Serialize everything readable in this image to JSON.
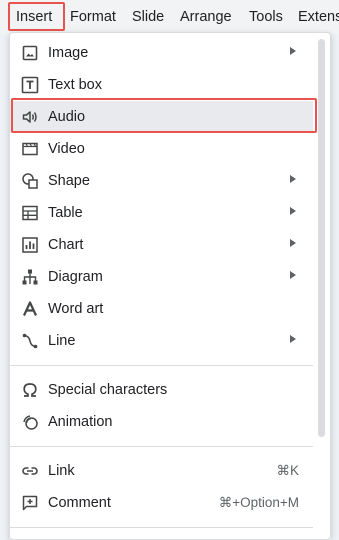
{
  "menubar": {
    "items": [
      "Insert",
      "Format",
      "Slide",
      "Arrange",
      "Tools",
      "Extens"
    ],
    "active": "Insert"
  },
  "dropdown": {
    "items": [
      {
        "label": "Image",
        "icon": "image-icon",
        "submenu": true
      },
      {
        "label": "Text box",
        "icon": "text-box-icon",
        "submenu": false
      },
      {
        "label": "Audio",
        "icon": "audio-icon",
        "submenu": false,
        "highlighted": true
      },
      {
        "label": "Video",
        "icon": "video-icon",
        "submenu": false
      },
      {
        "label": "Shape",
        "icon": "shape-icon",
        "submenu": true
      },
      {
        "label": "Table",
        "icon": "table-icon",
        "submenu": true
      },
      {
        "label": "Chart",
        "icon": "chart-icon",
        "submenu": true
      },
      {
        "label": "Diagram",
        "icon": "diagram-icon",
        "submenu": true
      },
      {
        "label": "Word art",
        "icon": "word-art-icon",
        "submenu": false
      },
      {
        "label": "Line",
        "icon": "line-icon",
        "submenu": true
      },
      {
        "label": "Special characters",
        "icon": "omega-icon",
        "submenu": false
      },
      {
        "label": "Animation",
        "icon": "animation-icon",
        "submenu": false
      },
      {
        "label": "Link",
        "icon": "link-icon",
        "submenu": false,
        "shortcut": "⌘K"
      },
      {
        "label": "Comment",
        "icon": "comment-icon",
        "submenu": false,
        "shortcut": "⌘+Option+M"
      }
    ]
  },
  "colors": {
    "highlight_border": "#e8534d",
    "hover_bg": "#e8eaed",
    "icon": "#444746"
  }
}
